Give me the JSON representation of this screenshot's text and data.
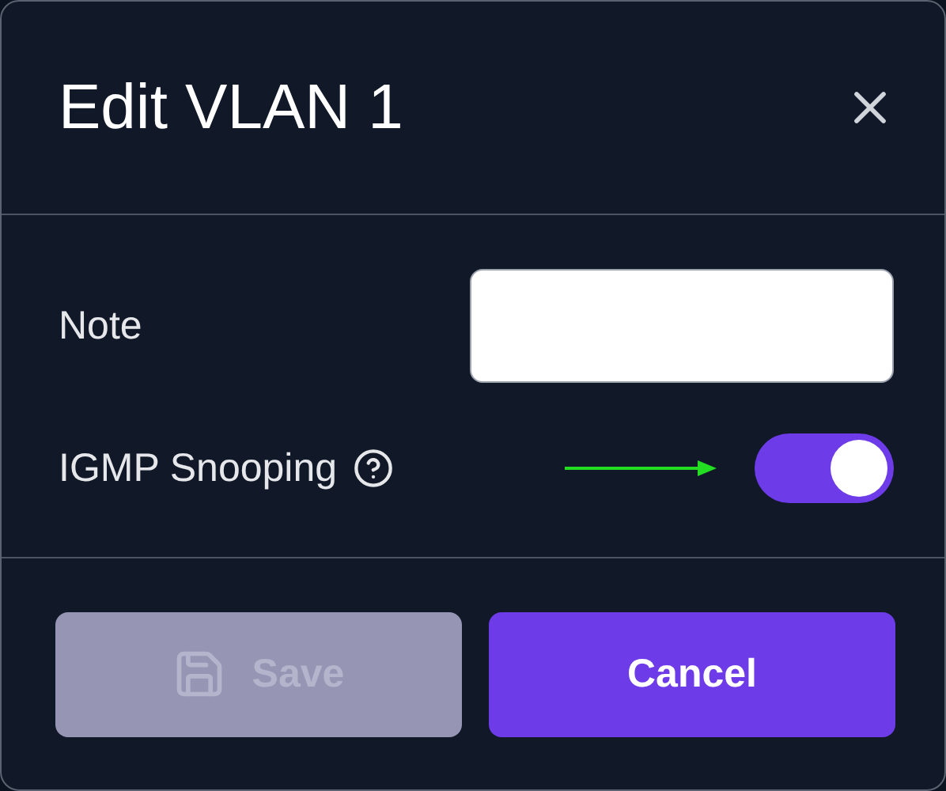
{
  "dialog": {
    "title": "Edit VLAN 1"
  },
  "fields": [
    {
      "kind": "text",
      "label": "Note"
    },
    {
      "kind": "toggle",
      "label": "IGMP Snooping",
      "help": true,
      "annotated": true,
      "on": true
    }
  ],
  "buttons": [
    {
      "label": "Save",
      "kind": "save",
      "disabled": true
    },
    {
      "label": "Cancel",
      "kind": "cancel",
      "disabled": false
    }
  ]
}
